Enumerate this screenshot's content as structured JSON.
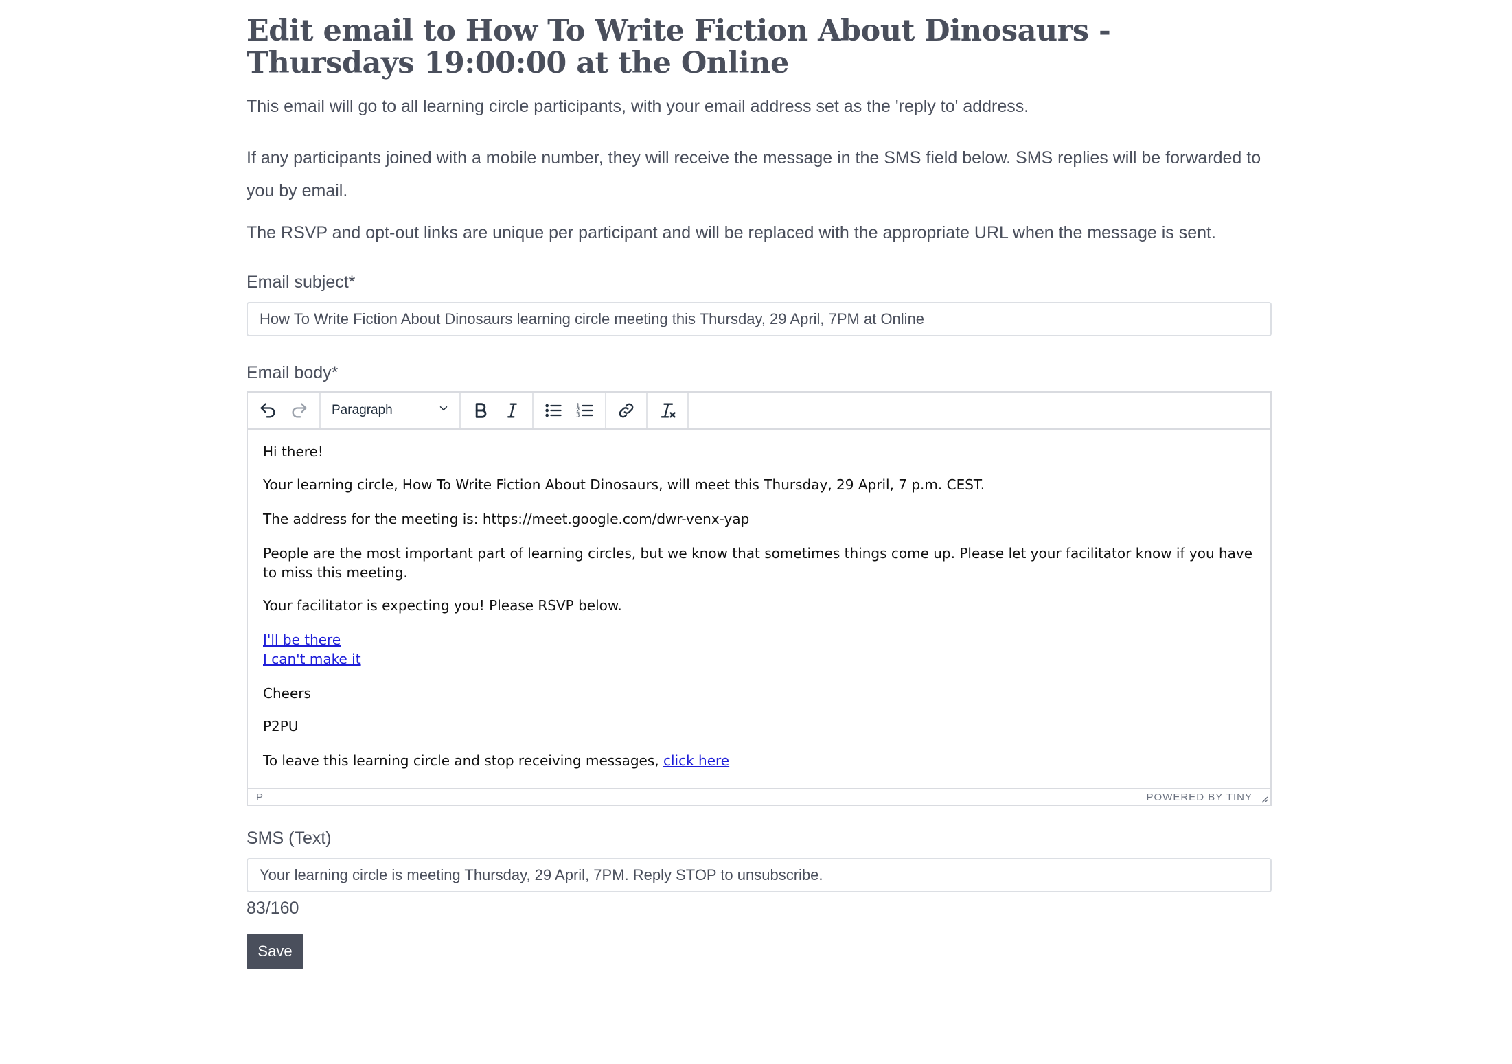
{
  "page": {
    "title": "Edit email to How To Write Fiction About Dinosaurs - Thursdays 19:00:00 at the Online",
    "intro": [
      "This email will go to all learning circle participants, with your email address set as the 'reply to' address.",
      "If any participants joined with a mobile number, they will receive the message in the SMS field below. SMS replies will be forwarded to you by email.",
      "The RSVP and opt-out links are unique per participant and will be replaced with the appropriate URL when the message is sent."
    ]
  },
  "subject": {
    "label": "Email subject*",
    "value": "How To Write Fiction About Dinosaurs learning circle meeting this Thursday, 29 April, 7PM at Online"
  },
  "body": {
    "label": "Email body*",
    "toolbar": {
      "block_format": "Paragraph",
      "icons": [
        "undo-icon",
        "redo-icon",
        "bold-icon",
        "italic-icon",
        "bullet-list-icon",
        "numbered-list-icon",
        "link-icon",
        "clear-formatting-icon"
      ]
    },
    "content": {
      "greeting": "Hi there!",
      "meet": "Your learning circle, How To Write Fiction About Dinosaurs, will meet this Thursday, 29 April, 7 p.m. CEST.",
      "address": "The address for the meeting is: https://meet.google.com/dwr-venx-yap",
      "importance": "People are the most important part of learning circles, but we know that sometimes things come up. Please let your facilitator know if you have to miss this meeting.",
      "expecting": "Your facilitator is expecting you! Please RSVP below.",
      "rsvp_yes": "I'll be there",
      "rsvp_no": "I can't make it",
      "cheers": "Cheers",
      "signoff": "P2PU",
      "leave_text": "To leave this learning circle and stop receiving messages, ",
      "leave_link": "click here"
    },
    "status": {
      "path": "P",
      "brand": "POWERED BY TINY"
    }
  },
  "sms": {
    "label": "SMS (Text)",
    "value": "Your learning circle is meeting Thursday, 29 April, 7PM. Reply STOP to unsubscribe.",
    "counter": "83/160"
  },
  "save_label": "Save",
  "colors": {
    "text": "#4a4f5c",
    "button_bg": "#4a4f5c",
    "link": "#1f1fd9",
    "border": "#d9dbe0"
  }
}
